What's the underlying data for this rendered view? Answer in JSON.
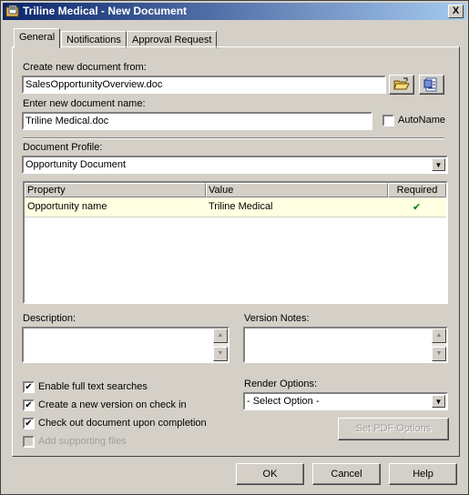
{
  "window": {
    "title": "Triline Medical - New Document",
    "close_glyph": "X"
  },
  "tabs": [
    {
      "label": "General",
      "active": true
    },
    {
      "label": "Notifications",
      "active": false
    },
    {
      "label": "Approval Request",
      "active": false
    }
  ],
  "create_from": {
    "label": "Create new document from:",
    "value": "SalesOpportunityOverview.doc"
  },
  "doc_name": {
    "label": "Enter new document name:",
    "value": "Triline Medical.doc",
    "autoname_label": "AutoName",
    "autoname_checked": false
  },
  "profile": {
    "label": "Document Profile:",
    "value": "Opportunity Document"
  },
  "grid": {
    "columns": [
      "Property",
      "Value",
      "Required"
    ],
    "rows": [
      {
        "property": "Opportunity name",
        "value": "Triline Medical",
        "required": "✔"
      }
    ]
  },
  "description": {
    "label": "Description:",
    "value": ""
  },
  "version_notes": {
    "label": "Version Notes:",
    "value": ""
  },
  "options": [
    {
      "label": "Enable full text searches",
      "checked": true,
      "enabled": true
    },
    {
      "label": "Create a new version on check in",
      "checked": true,
      "enabled": true
    },
    {
      "label": "Check out document upon completion",
      "checked": true,
      "enabled": true
    },
    {
      "label": "Add supporting files",
      "checked": false,
      "enabled": false
    }
  ],
  "render": {
    "label": "Render Options:",
    "value": "- Select Option -",
    "pdf_button": "Set PDF Options"
  },
  "footer": {
    "ok": "OK",
    "cancel": "Cancel",
    "help": "Help"
  },
  "check_glyph": "✔",
  "colors": {
    "required_check": "#008000",
    "title_start": "#0a246a",
    "title_end": "#a6caf0",
    "row_highlight": "#ffffe1"
  }
}
